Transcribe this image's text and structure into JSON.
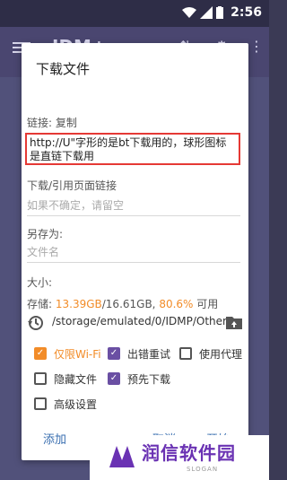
{
  "status": {
    "time": "2:56"
  },
  "appbar": {
    "title": "IDM+"
  },
  "dialog": {
    "title": "下载文件",
    "link_label": "链接: 复制",
    "url_value": "http://U\"字形的是bt下载用的，球形图标是直链下载用",
    "referer_label": "下载/引用页面链接",
    "referer_placeholder": "如果不确定，请留空",
    "saveas_label": "另存为:",
    "filename_placeholder": "文件名",
    "size_label": "大小:",
    "storage": {
      "prefix": "存储: ",
      "free": "13.39GB",
      "total": "/16.61GB, ",
      "percent": "80.6%",
      "suffix": " 可用"
    },
    "path": "/storage/emulated/0/IDMP/Others",
    "options": {
      "wifi_only": {
        "label": "仅限Wi-Fi",
        "checked": true
      },
      "retry_on_error": {
        "label": "出错重试",
        "checked": true
      },
      "use_proxy": {
        "label": "使用代理",
        "checked": false
      },
      "hide_file": {
        "label": "隐藏文件",
        "checked": false
      },
      "schedule": {
        "label": "预先下载",
        "checked": true
      },
      "advanced": {
        "label": "高级设置",
        "checked": false
      }
    },
    "buttons": {
      "add": "添加",
      "cancel": "取消",
      "start": "开始"
    }
  },
  "watermark": {
    "text": "润信软件园",
    "sub": "SLOGAN"
  },
  "colors": {
    "accent_orange": "#f28c28",
    "check_purple": "#6a4fa3",
    "highlight_red": "#e53935"
  }
}
